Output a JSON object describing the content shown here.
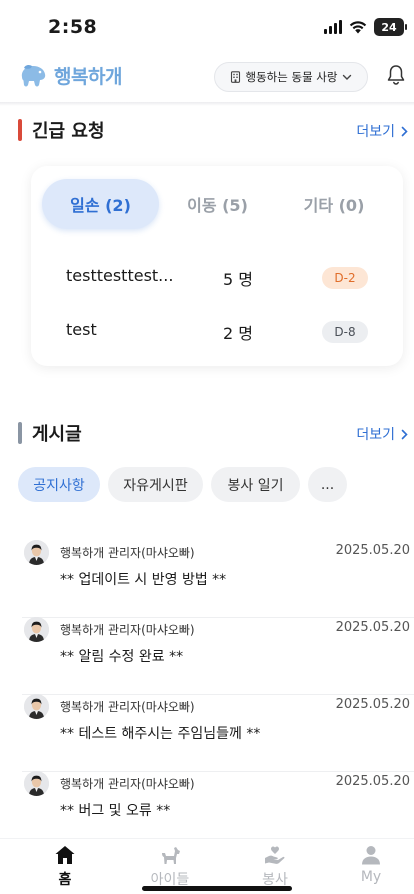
{
  "status_bar": {
    "time": "2:58",
    "battery": "24"
  },
  "header": {
    "logo_text": "행복하개",
    "shelter_label": "행동하는 동물 사랑"
  },
  "urgent": {
    "title": "긴급 요청",
    "more_label": "더보기",
    "tabs": [
      {
        "label": "일손 (2)",
        "active": true
      },
      {
        "label": "이동 (5)",
        "active": false
      },
      {
        "label": "기타 (0)",
        "active": false
      }
    ],
    "requests": [
      {
        "title": "testtesttest...",
        "count": "5 명",
        "dday": "D-2"
      },
      {
        "title": "test",
        "count": "2 명",
        "dday": "D-8"
      }
    ]
  },
  "posts": {
    "title": "게시글",
    "more_label": "더보기",
    "categories": [
      {
        "label": "공지사항",
        "active": true
      },
      {
        "label": "자유게시판",
        "active": false
      },
      {
        "label": "봉사 일기",
        "active": false
      },
      {
        "label": "...",
        "active": false
      }
    ],
    "items": [
      {
        "author": "행복하개 관리자(마샤오빠)",
        "date": "2025.05.20",
        "title": "** 업데이트 시 반영 방법 **"
      },
      {
        "author": "행복하개 관리자(마샤오빠)",
        "date": "2025.05.20",
        "title": "** 알림 수정 완료 **"
      },
      {
        "author": "행복하개 관리자(마샤오빠)",
        "date": "2025.05.20",
        "title": "** 테스트 해주시는 주임님들께 **"
      },
      {
        "author": "행복하개 관리자(마샤오빠)",
        "date": "2025.05.20",
        "title": "** 버그 및 오류 **"
      }
    ]
  },
  "tab_bar": {
    "items": [
      {
        "label": "홈",
        "icon": "home-icon",
        "active": true
      },
      {
        "label": "아이들",
        "icon": "dog-icon",
        "active": false
      },
      {
        "label": "봉사",
        "icon": "volunteer-hand-icon",
        "active": false
      },
      {
        "label": "My",
        "icon": "person-icon",
        "active": false
      }
    ]
  },
  "colors": {
    "accent": "#2f6fd3",
    "accent_light": "#dde8fa",
    "logo": "#6fa6dc",
    "urgent_bar": "#d94a3a",
    "posts_bar": "#8a95a3",
    "dday_warn_bg": "#fde6d5",
    "dday_warn_text": "#e06d2a"
  }
}
